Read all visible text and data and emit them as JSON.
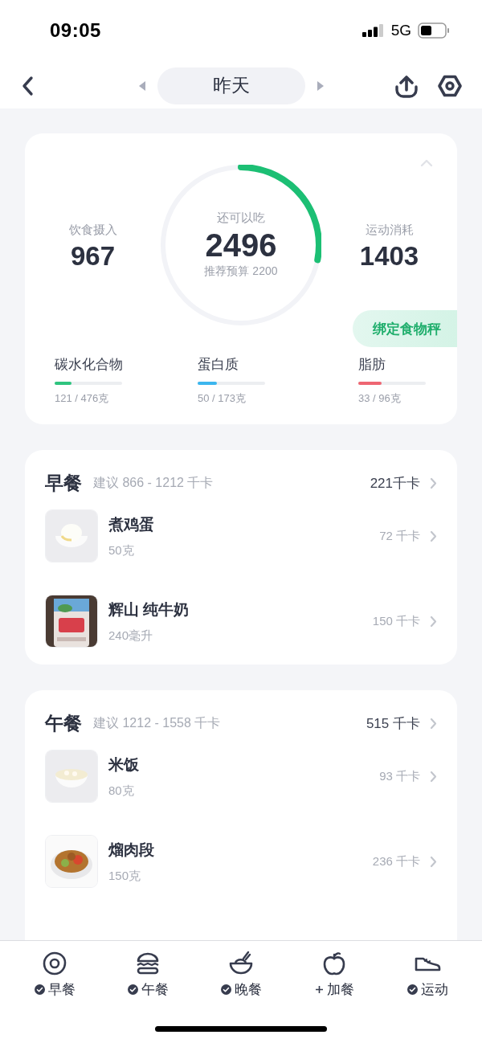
{
  "status_bar": {
    "time": "09:05",
    "network": "5G"
  },
  "nav": {
    "date": "昨天"
  },
  "summary": {
    "intake_label": "饮食摄入",
    "intake": "967",
    "remaining_label": "还可以吃",
    "remaining": "2496",
    "budget": "推荐预算 2200",
    "level": 0.28,
    "burn_label": "运动消耗",
    "burn": "1403",
    "scale_button": "绑定食物秤",
    "macros": [
      {
        "name": "碳水化合物",
        "value": "121 / 476克",
        "level": 0.25,
        "color": "#2fc47f"
      },
      {
        "name": "蛋白质",
        "value": "50 / 173克",
        "level": 0.29,
        "color": "#3cb6ee"
      },
      {
        "name": "脂肪",
        "value": "33 / 96克",
        "level": 0.34,
        "color": "#ee6672"
      }
    ]
  },
  "meals": [
    {
      "name": "早餐",
      "suggestion": "建议 866 - 1212 千卡",
      "total": "221千卡",
      "items": [
        {
          "name": "煮鸡蛋",
          "amount": "50克",
          "calories": "72 千卡"
        },
        {
          "name": "辉山 纯牛奶",
          "amount": "240毫升",
          "calories": "150 千卡"
        }
      ]
    },
    {
      "name": "午餐",
      "suggestion": "建议 1212 - 1558 千卡",
      "total": "515 千卡",
      "items": [
        {
          "name": "米饭",
          "amount": "80克",
          "calories": "93 千卡"
        },
        {
          "name": "熘肉段",
          "amount": "150克",
          "calories": "236 千卡"
        }
      ]
    }
  ],
  "tabs": [
    {
      "label": "早餐",
      "checked": true
    },
    {
      "label": "午餐",
      "checked": true
    },
    {
      "label": "晚餐",
      "checked": true
    },
    {
      "label": "加餐",
      "checked": false
    },
    {
      "label": "运动",
      "checked": true
    }
  ]
}
